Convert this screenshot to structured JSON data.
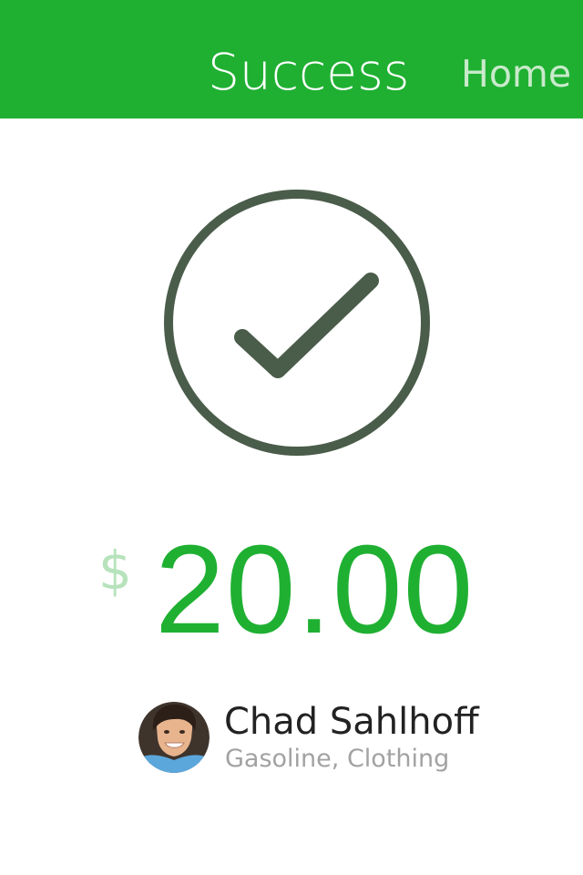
{
  "header": {
    "title": "Success",
    "home_label": "Home"
  },
  "status_icon": "checkmark-circle-icon",
  "payment": {
    "currency_symbol": "$",
    "amount": "20.00"
  },
  "recipient": {
    "name": "Chad Sahlhoff",
    "categories": "Gasoline, Clothing",
    "avatar_icon": "avatar-photo"
  },
  "colors": {
    "header_bg": "#1fb032",
    "accent": "#1fb032",
    "home_text": "#c9eacb",
    "currency_text": "#b7e3bc",
    "check_icon": "#4a5c4a",
    "name_text": "#222222",
    "categories_text": "#a2a2a2"
  }
}
